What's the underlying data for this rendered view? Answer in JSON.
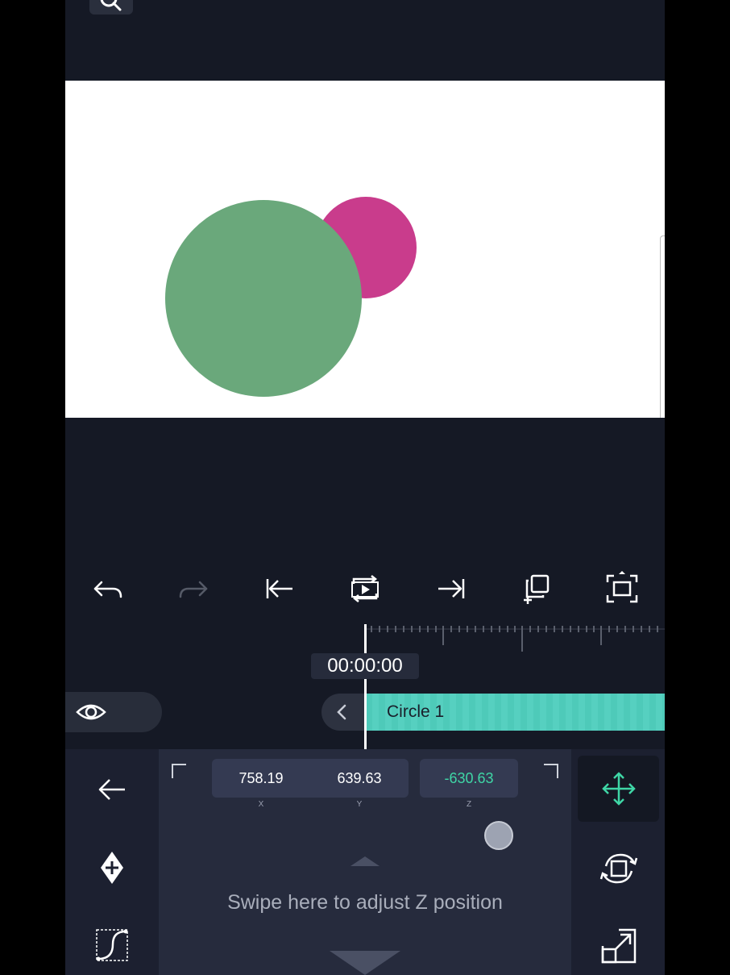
{
  "timeline": {
    "time": "00:00:00",
    "track_label": "Circle 1"
  },
  "transform": {
    "x_value": "758.19",
    "y_value": "639.63",
    "z_value": "-630.63",
    "x_label": "X",
    "y_label": "Y",
    "z_label": "Z",
    "hint": "Swipe here to adjust Z position"
  },
  "colors": {
    "accent": "#4ecab9",
    "z_value": "#3fd6a6",
    "green_circle": "#6aa87b",
    "pink_circle": "#c93c8c"
  },
  "icons": {
    "toolbar": [
      "undo-icon",
      "redo-icon",
      "jump-start-icon",
      "play-loop-icon",
      "jump-end-icon",
      "duplicate-icon",
      "fit-frame-icon"
    ],
    "left": [
      "back-arrow-icon",
      "add-keyframe-icon",
      "easing-curve-icon"
    ],
    "right": [
      "move-icon",
      "rotate-icon",
      "scale-icon"
    ]
  }
}
